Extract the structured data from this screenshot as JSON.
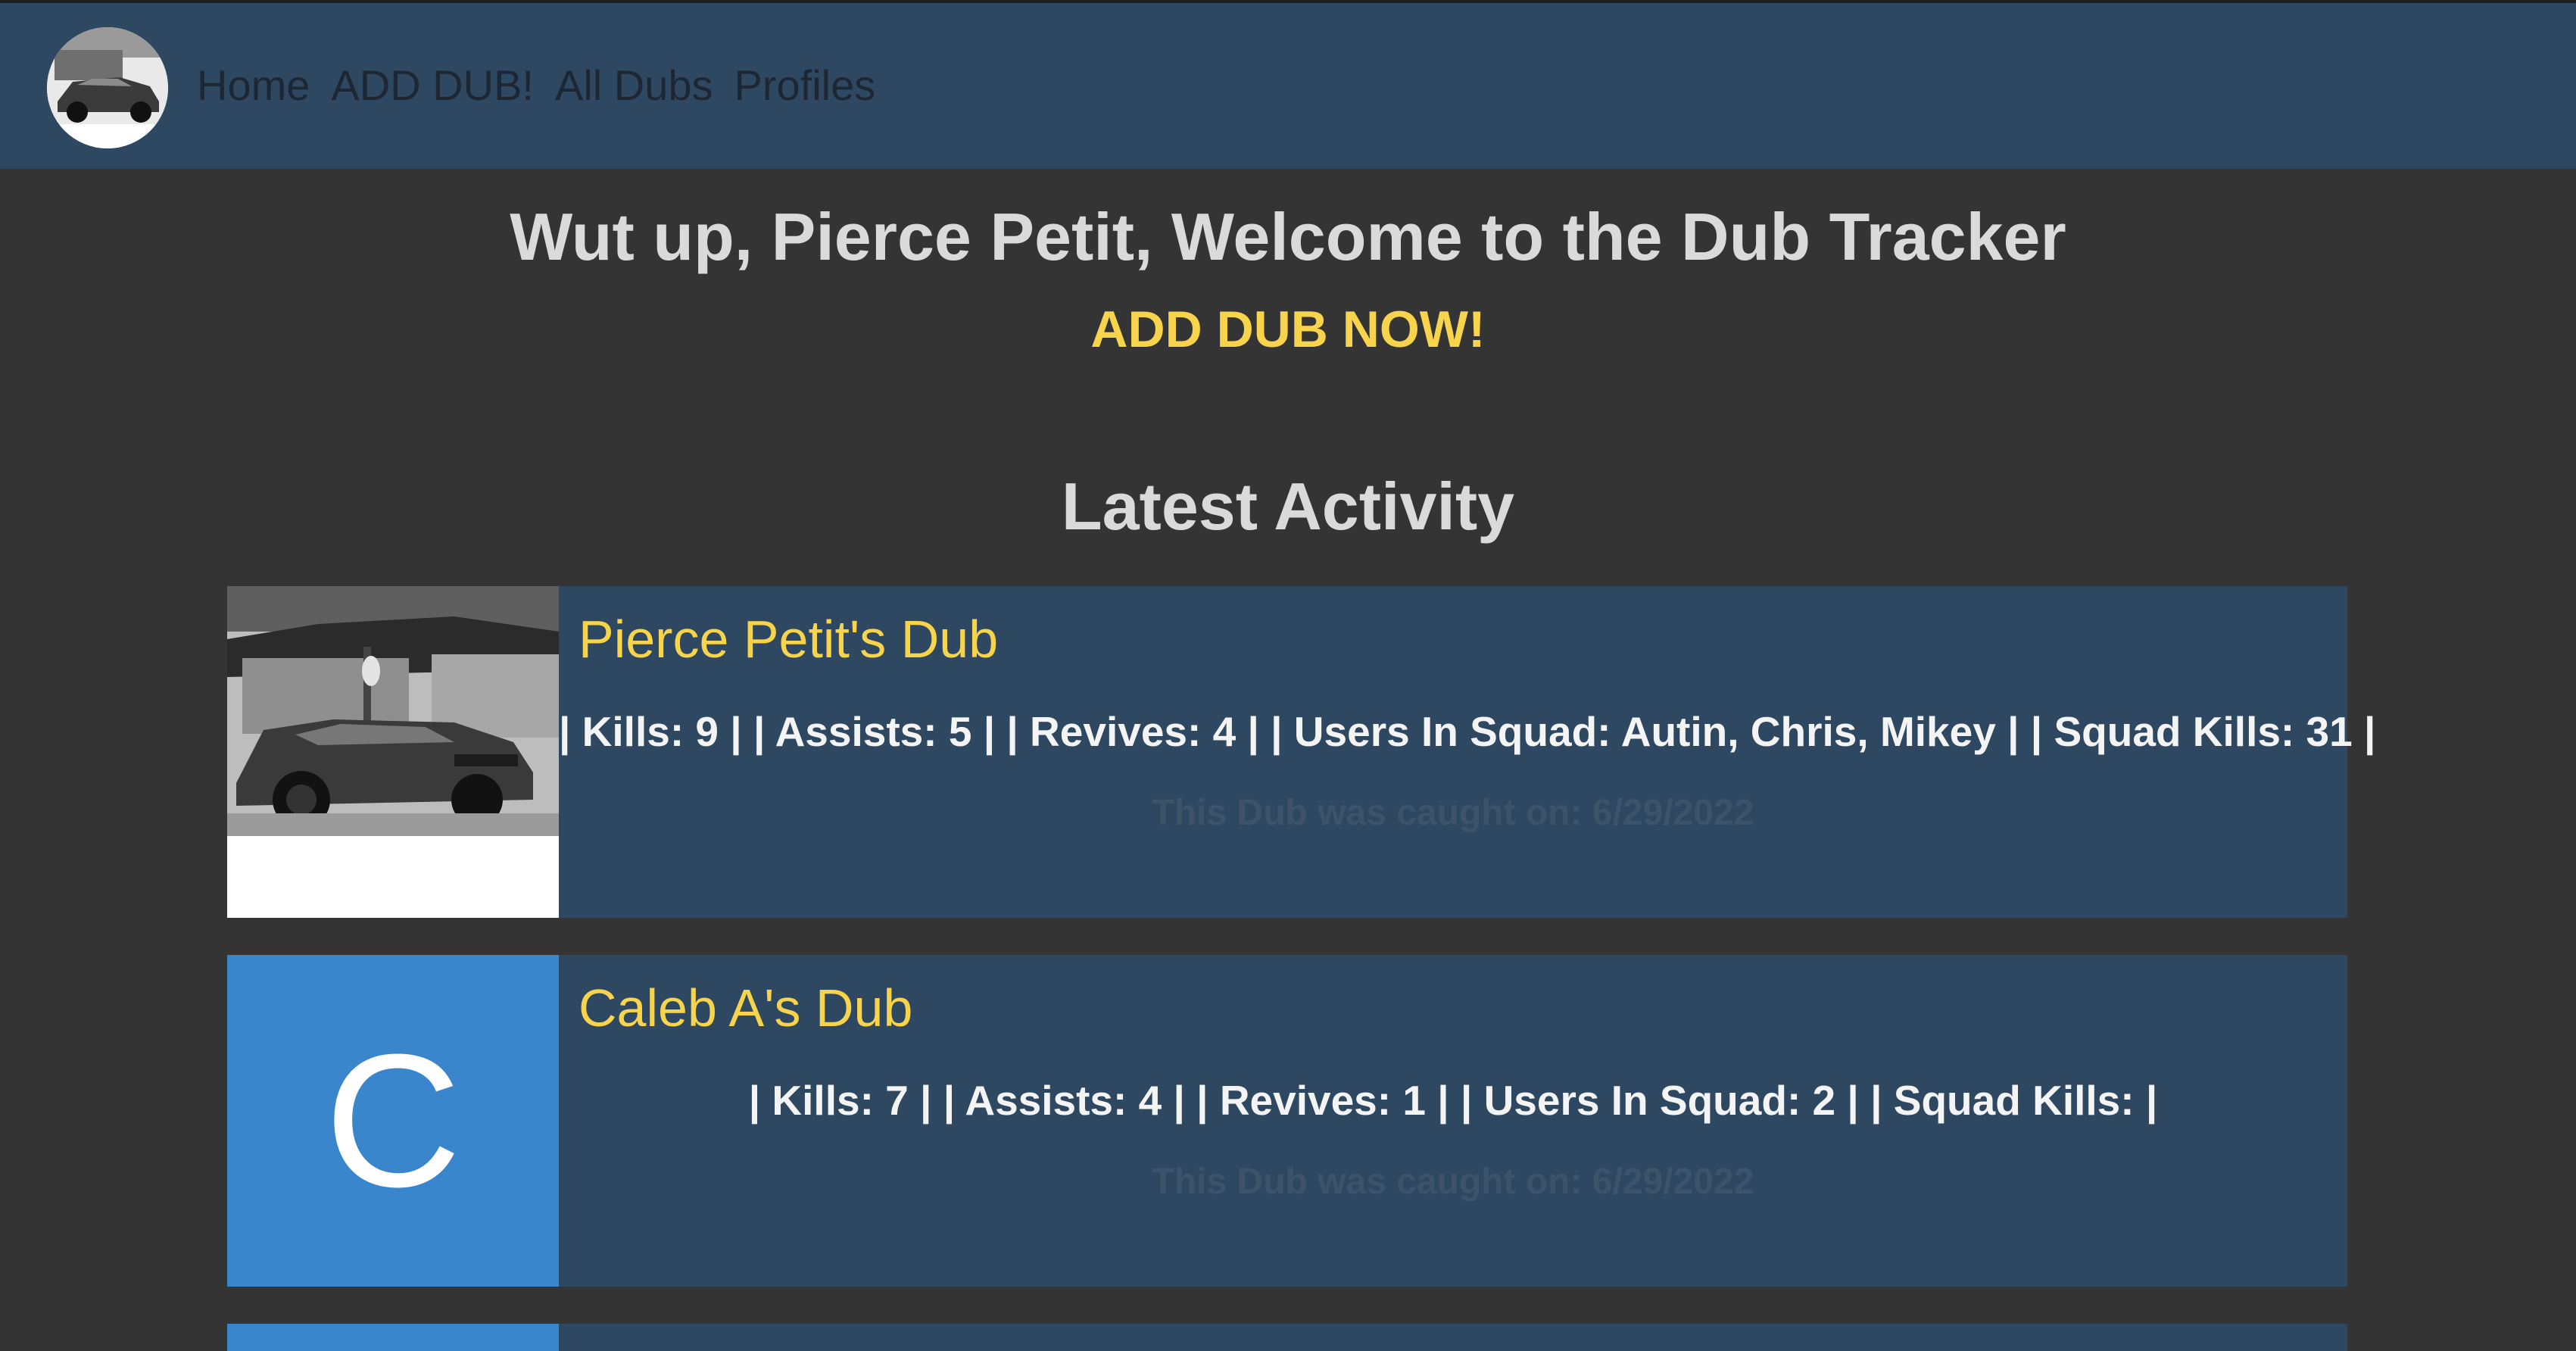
{
  "nav": {
    "logo_icon": "car-avatar-icon",
    "links": [
      "Home",
      "ADD DUB!",
      "All Dubs",
      "Profiles"
    ]
  },
  "main": {
    "welcome": "Wut up, Pierce Petit, Welcome to the Dub Tracker",
    "add_now": "ADD DUB NOW!",
    "latest_heading": "Latest Activity"
  },
  "activity": [
    {
      "title": "Pierce Petit's Dub",
      "thumb": "car-photo",
      "stats": "| Kills: 9 | | Assists: 5 | | Revives: 4 | | Users In Squad: Autin, Chris, Mikey | | Squad Kills: 31 |",
      "date": "This Dub was caught on: 6/29/2022"
    },
    {
      "title": "Caleb A's Dub",
      "thumb_letter": "C",
      "stats": "| Kills: 7 | | Assists: 4 | | Revives: 1 | | Users In Squad: 2 | | Squad Kills: |",
      "date": "This Dub was caught on: 6/29/2022"
    }
  ],
  "colors": {
    "page_bg": "#343434",
    "nav_bg": "#2f4861",
    "accent_yellow": "#f7d44c",
    "avatar_blue": "#3a86cc"
  }
}
